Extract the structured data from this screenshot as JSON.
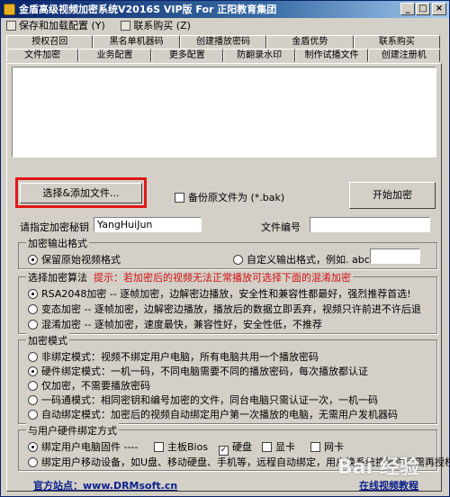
{
  "window": {
    "title": "金盾高级视频加密系统V2016S VIP版 For 正阳教育集团",
    "controls": [
      "_",
      "□",
      "×"
    ]
  },
  "menu": [
    {
      "label": "保存和加载配置 (Y)",
      "icon": "save-icon"
    },
    {
      "label": "联系购买 (Z)",
      "icon": "contact-icon"
    }
  ],
  "tabs_row1": [
    "授权召回",
    "黑名单机器码",
    "创建播放密码",
    "金盾优势",
    "联系购买"
  ],
  "tabs_row2": [
    "文件加密",
    "业务配置",
    "更多配置",
    "防翻录水印",
    "制作试播文件",
    "创建注册机"
  ],
  "active_tab": "文件加密",
  "actions": {
    "select_add": "选择&添加文件...",
    "backup_label": "备份原文件为 (*.bak)",
    "start": "开始加密"
  },
  "key_field": {
    "label": "请指定加密秘钥",
    "value": "YangHuiJun"
  },
  "file_no": {
    "label": "文件编号",
    "value": ""
  },
  "output_format": {
    "title": "加密输出格式",
    "keep": "保留原始视频格式",
    "custom": "自定义输出格式，例如. abc",
    "custom_value": ""
  },
  "algorithm": {
    "title": "选择加密算法",
    "hint": "提示：若加密后的视频无法正常播放可选择下面的混淆加密",
    "options": [
      {
        "label": "RSA2048加密 --  逐帧加密，边解密边播放，安全性和兼容性都最好，强烈推荐首选!",
        "on": true
      },
      {
        "label": "变态加密 -- 逐帧加密，边解密边播放，播放后的数据立即丢弃，视频只许前进不许后退",
        "on": false
      },
      {
        "label": "混淆加密 -- 逐帧加密，速度最快，兼容性好，安全性低，不推荐",
        "on": false
      }
    ]
  },
  "mode": {
    "title": "加密模式",
    "options": [
      {
        "label": "非绑定模式：视频不绑定用户电脑，所有电脑共用一个播放密码",
        "on": false
      },
      {
        "label": "硬件绑定模式：一机一码，不同电脑需要不同的播放密码，每次播放都认证",
        "on": true
      },
      {
        "label": "仅加密，不需要播放密码",
        "on": false
      },
      {
        "label": "一码通模式：相同密钥和编号加密的文件，同台电脑只需认证一次，一机一码",
        "on": false
      },
      {
        "label": "自动绑定模式：加密后的视频自动绑定用户第一次播放的电脑，无需用户发机器码",
        "on": false
      }
    ]
  },
  "binding": {
    "title": "与用户硬件绑定方式",
    "pc_label": "绑定用户电脑固件 ----",
    "hw": [
      {
        "label": "主板Bios",
        "checked": false
      },
      {
        "label": "硬盘",
        "checked": true
      },
      {
        "label": "显卡",
        "checked": false
      },
      {
        "label": "网卡",
        "checked": false
      }
    ],
    "mobile_label": "绑定用户移动设备，如U盘、移动硬盘、手机等，远程自动绑定，用户换系统换硬件后需再授权"
  },
  "footer": {
    "site": "官方站点：www.DRMsoft.cn",
    "video": "在线视频教程"
  },
  "watermark": "Bai 经验"
}
